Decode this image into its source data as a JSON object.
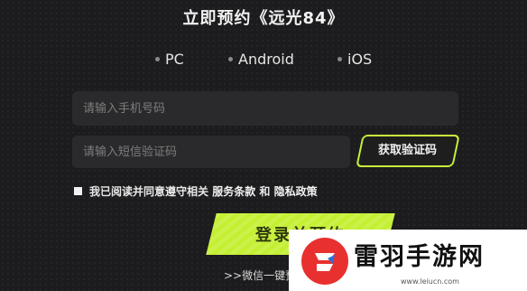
{
  "page": {
    "title": "立即预约《远光84》"
  },
  "platforms": [
    {
      "label": "PC"
    },
    {
      "label": "Android"
    },
    {
      "label": "iOS"
    }
  ],
  "form": {
    "phone_placeholder": "请输入手机号码",
    "code_placeholder": "请输入短信验证码",
    "get_code_label": "获取验证码",
    "agree_prefix": "我已阅读并同意遵守相关",
    "terms_label": "服务条款",
    "and_label": "和",
    "privacy_label": "隐私政策",
    "submit_label": "登录并预约",
    "wechat_label": ">>微信一键预约"
  },
  "watermark": {
    "brand": "雷羽手游网",
    "url": "www.leiucn.com"
  },
  "colors": {
    "accent": "#c4ef32",
    "background": "#1c1c1e",
    "field": "#2a2a2c"
  }
}
